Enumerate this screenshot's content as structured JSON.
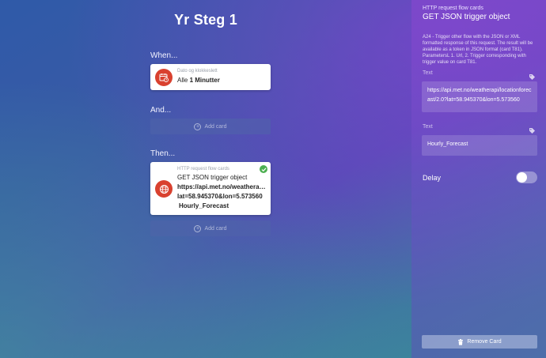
{
  "page": {
    "title": "Yr Steg 1"
  },
  "when": {
    "label": "When...",
    "card": {
      "category": "Dato og klokkeslett",
      "prefix": "Alle",
      "value": "1 Minutter",
      "icon": "calendar-clock-icon"
    }
  },
  "and": {
    "label": "And...",
    "add_label": "Add card"
  },
  "then": {
    "label": "Then...",
    "card": {
      "category": "HTTP request flow cards",
      "title": "GET JSON trigger object",
      "url_line1": "https://api.met.no/weatherapi/l...",
      "url_line2": "lat=58.945370&lon=5.573560",
      "value": "Hourly_Forecast",
      "icon": "globe-icon"
    },
    "add_label": "Add card"
  },
  "sidebar": {
    "category": "HTTP request flow cards",
    "title": "GET JSON trigger object",
    "description": "A24 - Trigger other flow with the JSON or XML formatted response of this request. The result will be available as a token in JSON format (card T81). ParametersL 1. Url, 2. Trigger corresponding with trigger value on card T81.",
    "field1": {
      "label": "Text",
      "value": "https://api.met.no/weatherapi/locationforecast/2.0?lat=58.945370&lon=5.573560"
    },
    "field2": {
      "label": "Text",
      "value": "Hourly_Forecast"
    },
    "delay": {
      "label": "Delay",
      "enabled": false
    },
    "remove_label": "Remove Card"
  },
  "colors": {
    "accent_red": "#d9412f",
    "success_green": "#4caf50"
  }
}
